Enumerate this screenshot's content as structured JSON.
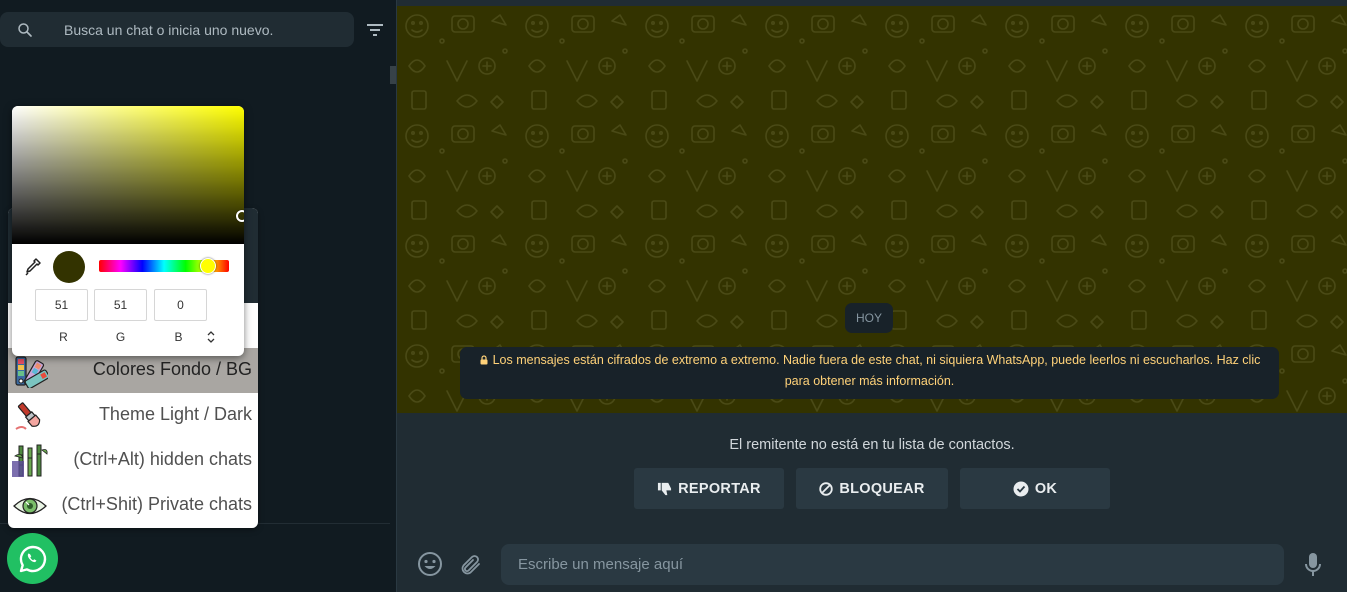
{
  "sidebar": {
    "search": {
      "placeholder": "Busca un chat o inicia uno nuevo.",
      "icon": "search-icon"
    },
    "filter_icon": "filter-icon",
    "menu": {
      "items": [
        {
          "label": "Colores Fondo / BG",
          "icon": "color-palette-icon",
          "active": true
        },
        {
          "label": "Theme Light / Dark",
          "icon": "paint-brush-icon",
          "active": false
        },
        {
          "label": "(Ctrl+Alt) hidden chats",
          "icon": "bamboo-icon",
          "active": false
        },
        {
          "label": "(Ctrl+Shit) Private chats",
          "icon": "eye-icon",
          "active": false
        }
      ]
    },
    "color_picker": {
      "hue_color": "#ffff00",
      "selected_color": "#333300",
      "r": "51",
      "g": "51",
      "b": "0",
      "r_label": "R",
      "g_label": "G",
      "b_label": "B",
      "mode_toggle": "⌃⌄"
    },
    "whatsapp_button_icon": "whatsapp-icon"
  },
  "conversation": {
    "background_color": "#333300",
    "date_chip": "HOY",
    "encryption_notice": "Los mensajes están cifrados de extremo a extremo. Nadie fuera de este chat, ni siquiera WhatsApp, puede leerlos ni escucharlos. Haz clic para obtener más información.",
    "unknown_sender": {
      "text": "El remitente no está en tu lista de contactos.",
      "buttons": [
        {
          "label": "REPORTAR",
          "icon": "thumbs-down-icon"
        },
        {
          "label": "BLOQUEAR",
          "icon": "block-icon"
        },
        {
          "label": "OK",
          "icon": "check-circle-icon"
        }
      ]
    },
    "footer": {
      "message_placeholder": "Escribe un mensaje aquí",
      "emoji_icon": "emoji-icon",
      "attach_icon": "paperclip-icon",
      "mic_icon": "microphone-icon"
    }
  },
  "colors": {
    "sidebar_bg": "#111b21",
    "panel_bg": "#202c33",
    "input_bg": "#2a3942",
    "accent_green": "#21c063",
    "notice_text": "#ffd279"
  }
}
